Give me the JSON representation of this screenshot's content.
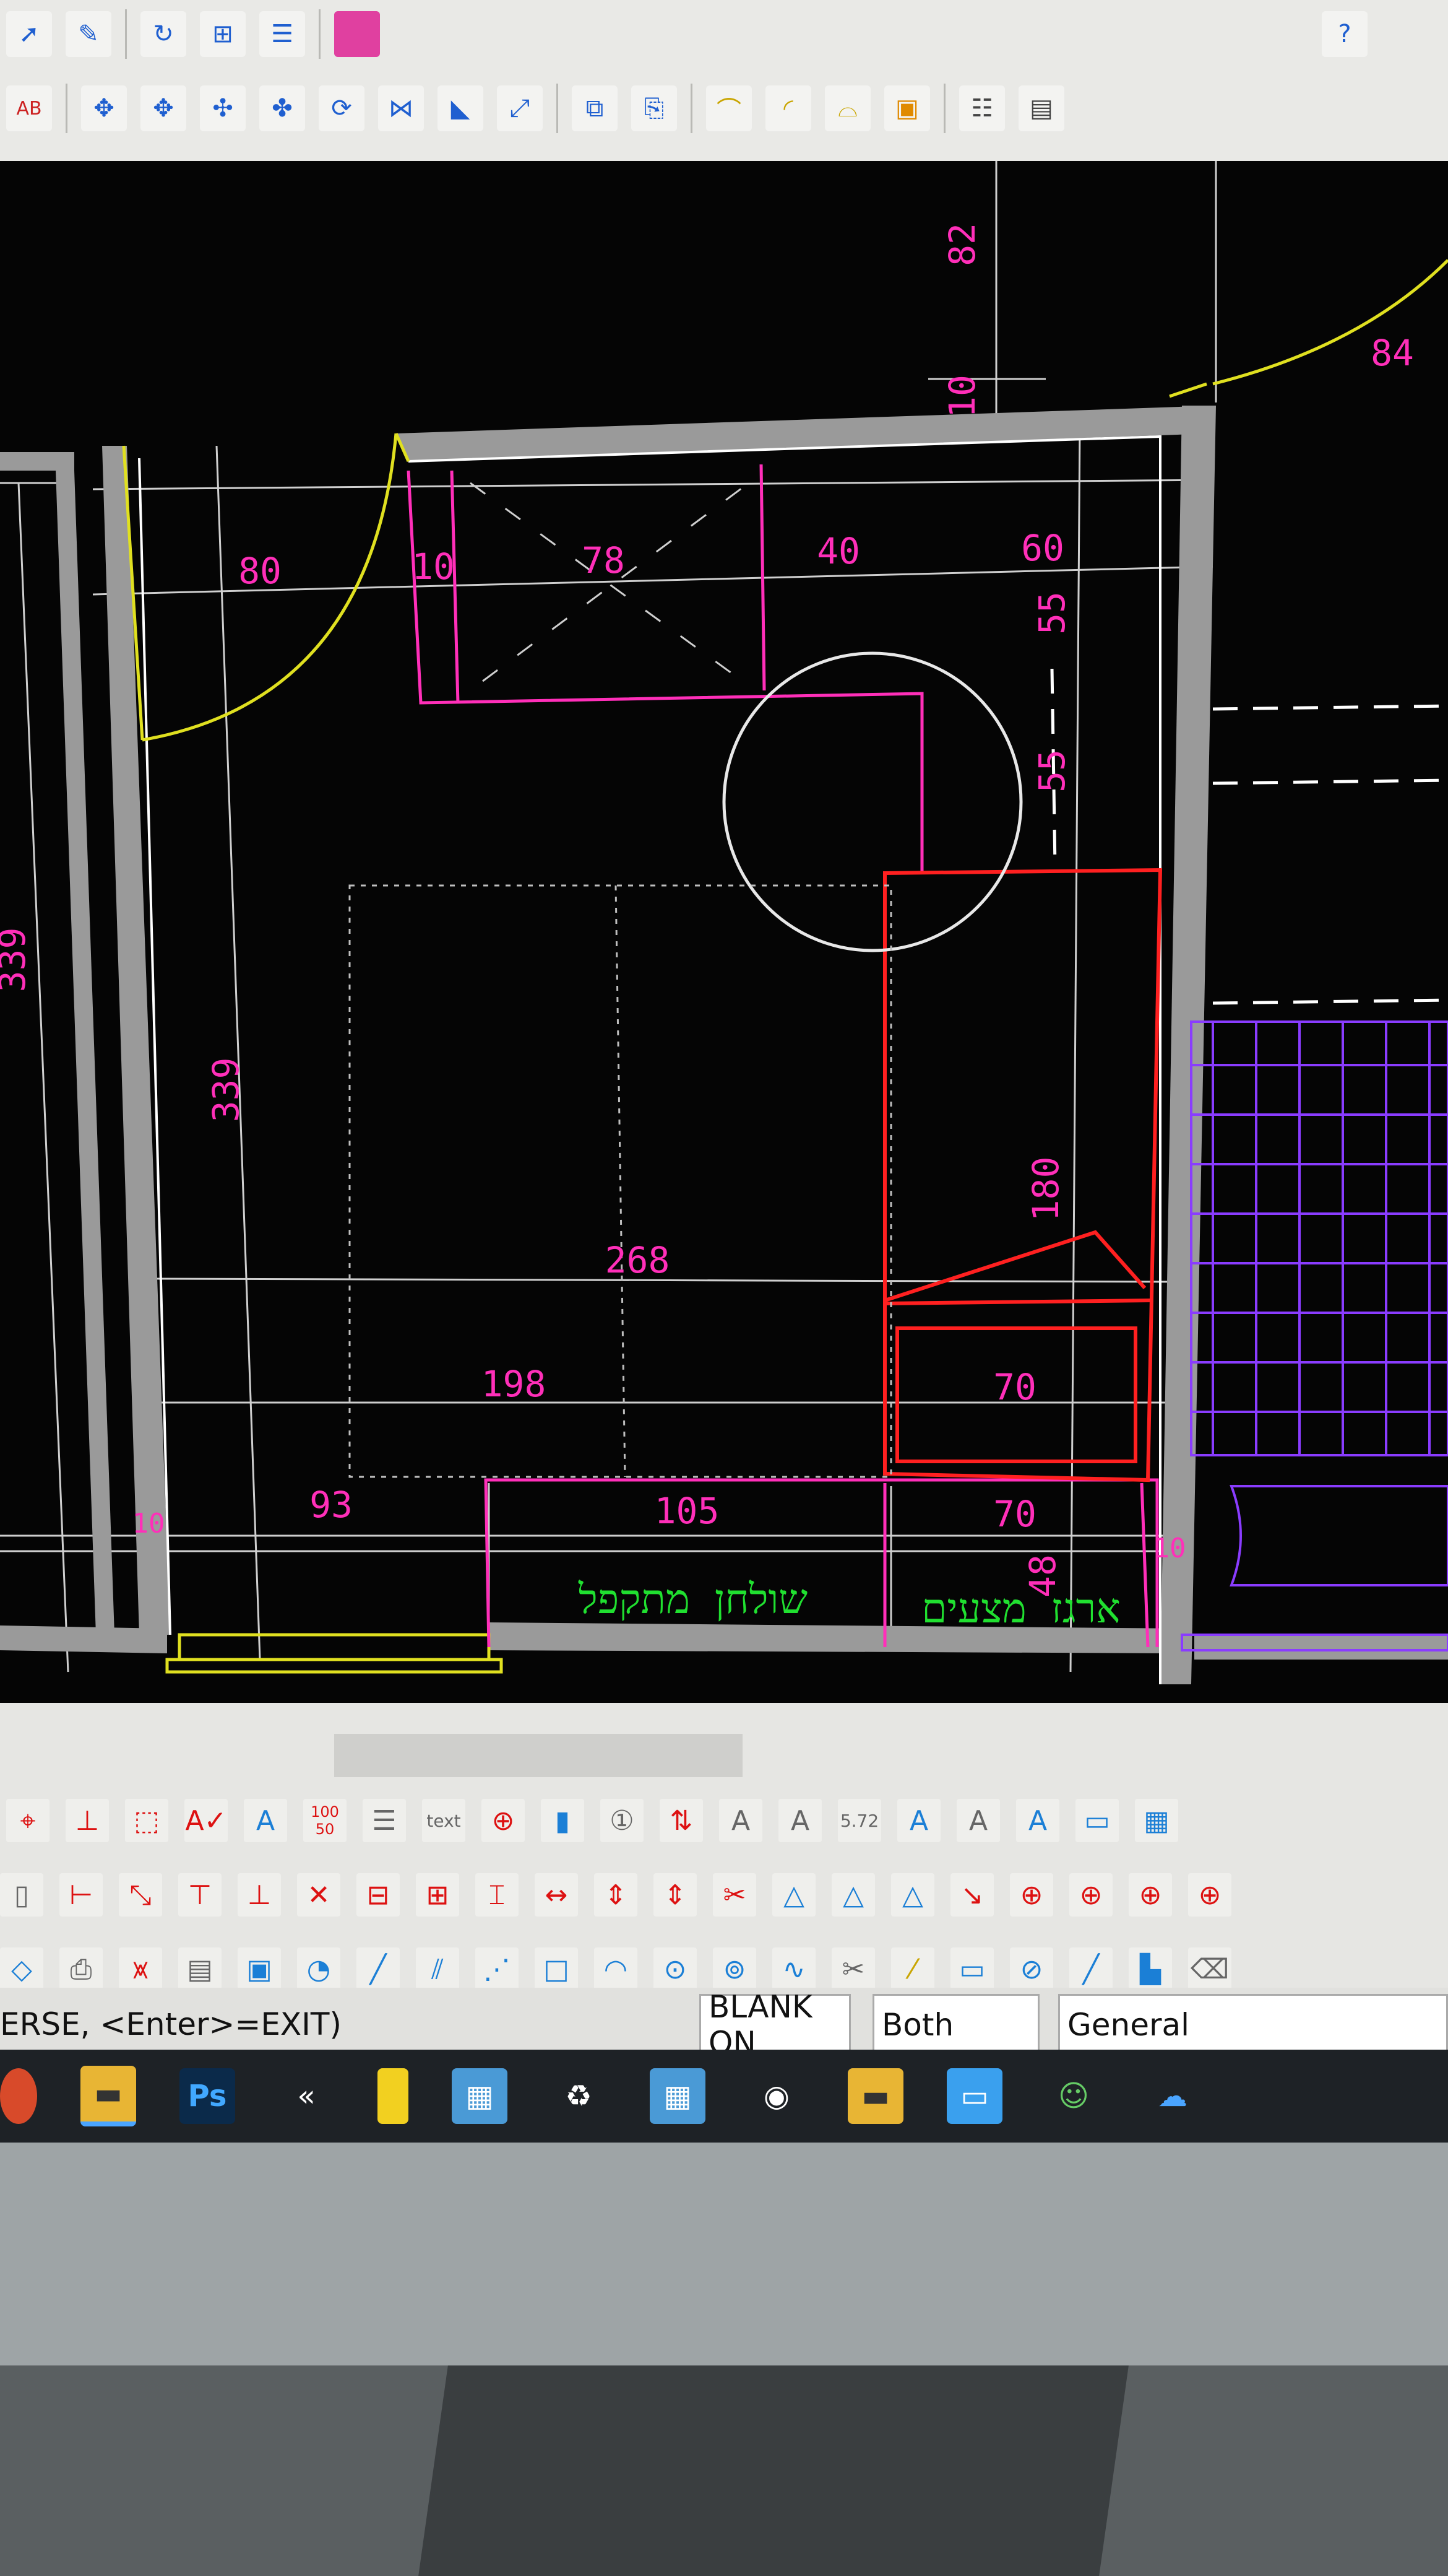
{
  "top_toolbar": {
    "row1": [
      "pointer-icon",
      "brush-icon",
      "rotate-icon",
      "insert-icon",
      "layer-icon",
      "palette-icon",
      "help-icon"
    ],
    "row2": [
      "text-replace-icon",
      "move-icon",
      "move-copy-icon",
      "move-icon",
      "move-icon",
      "rotate-icon",
      "mirror-icon",
      "stretch-icon",
      "scale-icon",
      "duplicate-icon",
      "door-icon",
      "arc-icon",
      "arc-icon",
      "block-icon",
      "list-icon",
      "save-icon"
    ],
    "help_label": "?"
  },
  "drawing": {
    "dimensions": {
      "top_82": "82",
      "top_10": "10",
      "right_84": "84",
      "d80": "80",
      "d10": "10",
      "d78": "78",
      "d40": "40",
      "d60": "60",
      "d55a": "55",
      "d55b": "55",
      "left_339_outer": "339",
      "left_339_inner": "339",
      "d180": "180",
      "d268": "268",
      "d198": "198",
      "d70_upper": "70",
      "d93": "93",
      "d105": "105",
      "d70_lower": "70",
      "d48": "48",
      "d10_left": "10",
      "d10_right": "10"
    },
    "labels": {
      "folding_table": "שולחן מתקפל",
      "linen_drawer": "ארגז מצעים"
    }
  },
  "bottom_toolbar": {
    "text_icons": [
      "A",
      "100 50",
      "text",
      "1",
      "BA AB",
      "A+",
      "A",
      "5.72",
      "A"
    ],
    "label_text": "text",
    "label_572": "5.72",
    "label_100": "100",
    "label_50": "50"
  },
  "status_bar": {
    "command": "ERSE, <Enter>=EXIT)",
    "blank": "BLANK ON",
    "both": "Both",
    "general": "General"
  },
  "taskbar": {
    "chevron": "«",
    "ps_label": "Ps"
  }
}
